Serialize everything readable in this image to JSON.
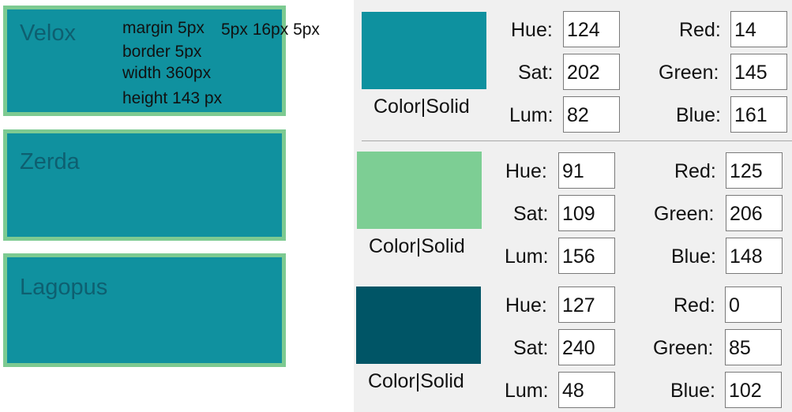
{
  "boxes": [
    {
      "name": "Velox"
    },
    {
      "name": "Zerda"
    },
    {
      "name": "Lagopus"
    }
  ],
  "annotations": {
    "margin": "margin 5px",
    "margin_rest": "5px 16px 5px",
    "border": "border 5px",
    "width": "width 360px",
    "height": "height 143 px"
  },
  "color_panels": [
    {
      "swatch_color": "#0e919f",
      "label": "Color|Solid",
      "hue_label": "Hue:",
      "hue": "124",
      "sat_label": "Sat:",
      "sat": "202",
      "lum_label": "Lum:",
      "lum": "82",
      "red_label": "Red:",
      "red": "14",
      "green_label": "Green:",
      "green": "145",
      "blue_label": "Blue:",
      "blue": "161"
    },
    {
      "swatch_color": "#7dce94",
      "label": "Color|Solid",
      "hue_label": "Hue:",
      "hue": "91",
      "sat_label": "Sat:",
      "sat": "109",
      "lum_label": "Lum:",
      "lum": "156",
      "red_label": "Red:",
      "red": "125",
      "green_label": "Green:",
      "green": "206",
      "blue_label": "Blue:",
      "blue": "148"
    },
    {
      "swatch_color": "#005566",
      "label": "Color|Solid",
      "hue_label": "Hue:",
      "hue": "127",
      "sat_label": "Sat:",
      "sat": "240",
      "lum_label": "Lum:",
      "lum": "48",
      "red_label": "Red:",
      "red": "0",
      "green_label": "Green:",
      "green": "85",
      "blue_label": "Blue:",
      "blue": "102"
    }
  ]
}
